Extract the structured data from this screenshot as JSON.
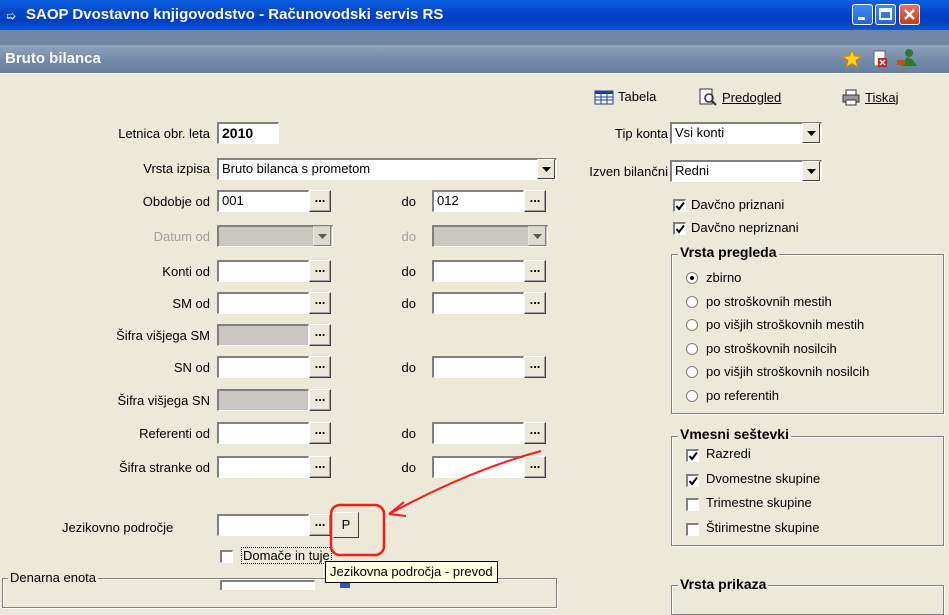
{
  "window": {
    "title": "SAOP  Dvostavno knjigovodstvo  - Računovodski servis RS",
    "subtitle": "Bruto bilanca"
  },
  "toolbar": {
    "tabela": "Tabela",
    "predogled": "Predogled",
    "tiskaj": "Tiskaj"
  },
  "form": {
    "letnica_label": "Letnica obr. leta",
    "letnica_value": "2010",
    "vrsta_izpisa_label": "Vrsta izpisa",
    "vrsta_izpisa_value": "Bruto bilanca s prometom",
    "obdobje_od_label": "Obdobje od",
    "obdobje_od_value": "001",
    "obdobje_do_label": "do",
    "obdobje_do_value": "012",
    "datum_od_label": "Datum od",
    "datum_do_label": "do",
    "konti_od_label": "Konti od",
    "konti_do_label": "do",
    "sm_od_label": "SM od",
    "sm_do_label": "do",
    "sifra_visjega_sm_label": "Šifra višjega SM",
    "sn_od_label": "SN od",
    "sn_do_label": "do",
    "sifra_visjega_sn_label": "Šifra višjega SN",
    "referenti_od_label": "Referenti od",
    "referenti_do_label": "do",
    "sifra_stranke_od_label": "Šifra stranke od",
    "sifra_stranke_do_label": "do",
    "jezikovno_label": "Jezikovno področje",
    "p_button": "P",
    "domace_label": "Domače in tuje",
    "denarna_enota_label": "Denarna enota",
    "dots": "..."
  },
  "right": {
    "tip_konta_label": "Tip konta",
    "tip_konta_value": "Vsi konti",
    "izven_label": "Izven bilančni",
    "izven_value": "Redni",
    "davcno_priznani": "Davčno priznani",
    "davcno_nepriznani": "Davčno nepriznani"
  },
  "vrsta_pregleda": {
    "title": "Vrsta pregleda",
    "options": [
      "zbirno",
      "po stroškovnih mestih",
      "po višjih stroškovnih mestih",
      "po stroškovnih nosilcih",
      "po višjih stroškovnih nosilcih",
      "po referentih"
    ],
    "selected": 0
  },
  "vmesni": {
    "title": "Vmesni seštevki",
    "options": [
      "Razredi",
      "Dvomestne skupine",
      "Trimestne skupine",
      "Štirimestne skupine"
    ],
    "checked": [
      true,
      true,
      false,
      false
    ]
  },
  "vrsta_prikaza": {
    "title": "Vrsta prikaza"
  },
  "tooltip": "Jezikovna področja - prevod",
  "colors": {
    "title_bar": "#0346c8",
    "sub_header": "#7289a8",
    "annotation": "#ff0000",
    "window_bg": "#ece9d8"
  }
}
